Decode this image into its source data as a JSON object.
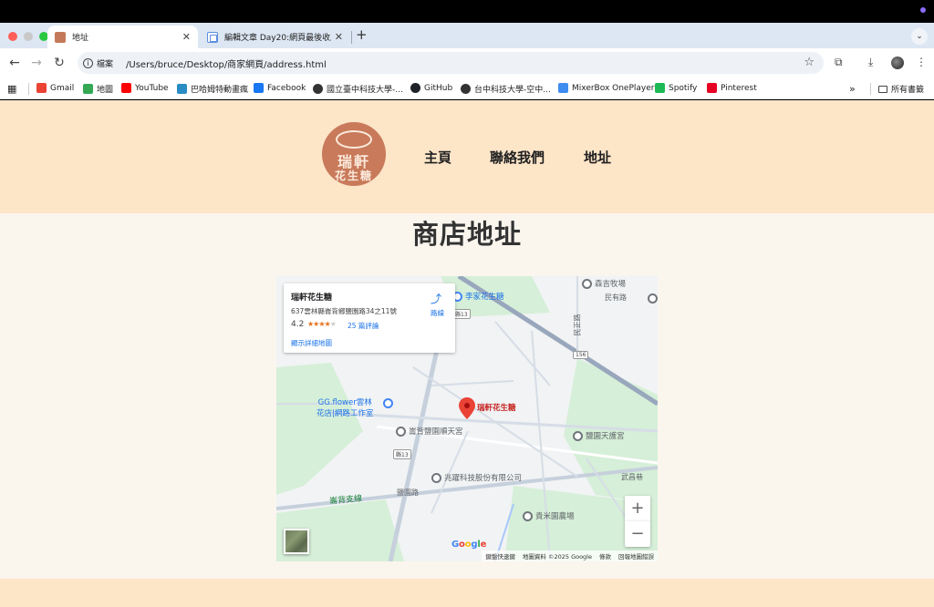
{
  "browser": {
    "tabs": [
      {
        "title": "地址",
        "active": true
      },
      {
        "title": "編輯文章 Day20:網頁最後收尾",
        "active": false
      }
    ],
    "address_chip": "檔案",
    "url": "/Users/bruce/Desktop/商家網頁/address.html",
    "bookmarks": [
      {
        "label": "Gmail",
        "icon": "gmail-icon",
        "color": "#ea4335"
      },
      {
        "label": "地圖",
        "icon": "maps-icon",
        "color": "#34a853"
      },
      {
        "label": "YouTube",
        "icon": "youtube-icon",
        "color": "#ff0000"
      },
      {
        "label": "巴哈姆特動畫瘋",
        "icon": "bahamut-icon",
        "color": "#2a8cc4"
      },
      {
        "label": "Facebook",
        "icon": "facebook-icon",
        "color": "#1877f2"
      },
      {
        "label": "國立臺中科技大學-...",
        "icon": "globe-icon",
        "color": "#333333"
      },
      {
        "label": "GitHub",
        "icon": "github-icon",
        "color": "#1f2328"
      },
      {
        "label": "台中科技大學-空中...",
        "icon": "globe-icon",
        "color": "#333333"
      },
      {
        "label": "MixerBox OnePlayer",
        "icon": "mixerbox-icon",
        "color": "#3d8cf0"
      },
      {
        "label": "Spotify",
        "icon": "spotify-icon",
        "color": "#1db954"
      },
      {
        "label": "Pinterest",
        "icon": "pinterest-icon",
        "color": "#e60023"
      }
    ],
    "all_bookmarks": "所有書籤"
  },
  "site": {
    "logo_text_1": "瑞軒",
    "logo_text_2": "花生糖",
    "nav": [
      "主頁",
      "聯絡我們",
      "地址"
    ],
    "page_title": "商店地址"
  },
  "map": {
    "card": {
      "name": "瑞軒花生糖",
      "address": "637雲林縣崙背鄉鹽園路34之11號",
      "rating": "4.2",
      "stars": 4,
      "reviews": "25 篇評論",
      "detail_link": "顯示詳細地圖",
      "directions": "路線"
    },
    "pois": {
      "shop": "瑞軒花生糖",
      "farm1": "森吉牧場",
      "farm1_sub": "民有路",
      "peanut": "李家花生糖",
      "flower1": "GG.flower雲林",
      "flower2": "花店|網路工作室",
      "temple1": "崙背鹽園順天宮",
      "temple2": "鹽園天護宮",
      "tech": "兆躍科技股份有限公司",
      "farm2": "貴米園農場",
      "road_wuguo": "武昌巷",
      "road_yanyuan": "鹽園路",
      "road_lunbei": "崙背支線",
      "road_minzheng": "民正路",
      "badge_13": "縣13",
      "badge_156": "156"
    },
    "footer": [
      "鍵盤快速鍵",
      "地圖資料 ©2025 Google",
      "條款",
      "回報地圖錯誤"
    ],
    "google_logo": "Google"
  },
  "colors": {
    "header_bg": "#fde5c8",
    "page_bg": "#faf6ee",
    "logo_bg": "#c87a5a",
    "map_bg": "#f1f3f4",
    "park_green": "#d6efd8"
  }
}
